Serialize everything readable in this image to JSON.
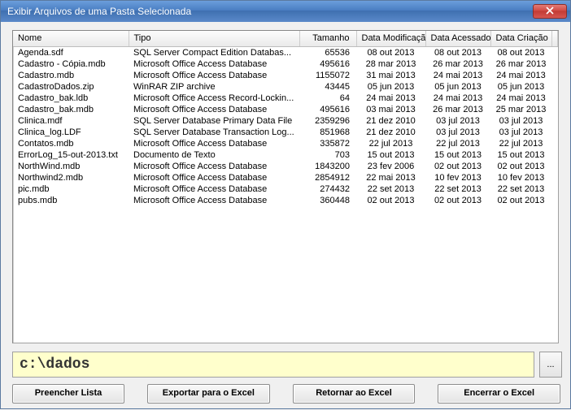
{
  "window": {
    "title": "Exibir Arquivos de uma Pasta Selecionada"
  },
  "columns": {
    "nome": "Nome",
    "tipo": "Tipo",
    "tamanho": "Tamanho",
    "modificacao": "Data Modificação",
    "acessado": "Data Acessado",
    "criacao": "Data Criação"
  },
  "rows": [
    {
      "nome": "Agenda.sdf",
      "tipo": "SQL Server Compact Edition Databas...",
      "tamanho": "65536",
      "mod": "08 out 2013",
      "acc": "08 out 2013",
      "cre": "08 out 2013"
    },
    {
      "nome": "Cadastro - Cópia.mdb",
      "tipo": "Microsoft Office Access Database",
      "tamanho": "495616",
      "mod": "28 mar 2013",
      "acc": "26 mar 2013",
      "cre": "26 mar 2013"
    },
    {
      "nome": "Cadastro.mdb",
      "tipo": "Microsoft Office Access Database",
      "tamanho": "1155072",
      "mod": "31 mai 2013",
      "acc": "24 mai 2013",
      "cre": "24 mai 2013"
    },
    {
      "nome": "CadastroDados.zip",
      "tipo": "WinRAR ZIP archive",
      "tamanho": "43445",
      "mod": "05 jun 2013",
      "acc": "05 jun 2013",
      "cre": "05 jun 2013"
    },
    {
      "nome": "Cadastro_bak.ldb",
      "tipo": "Microsoft Office Access Record-Lockin...",
      "tamanho": "64",
      "mod": "24 mai 2013",
      "acc": "24 mai 2013",
      "cre": "24 mai 2013"
    },
    {
      "nome": "Cadastro_bak.mdb",
      "tipo": "Microsoft Office Access Database",
      "tamanho": "495616",
      "mod": "03 mai 2013",
      "acc": "26 mar 2013",
      "cre": "25 mar 2013"
    },
    {
      "nome": "Clinica.mdf",
      "tipo": "SQL Server Database Primary Data File",
      "tamanho": "2359296",
      "mod": "21 dez 2010",
      "acc": "03 jul 2013",
      "cre": "03 jul 2013"
    },
    {
      "nome": "Clinica_log.LDF",
      "tipo": "SQL Server Database Transaction Log...",
      "tamanho": "851968",
      "mod": "21 dez 2010",
      "acc": "03 jul 2013",
      "cre": "03 jul 2013"
    },
    {
      "nome": "Contatos.mdb",
      "tipo": "Microsoft Office Access Database",
      "tamanho": "335872",
      "mod": "22 jul 2013",
      "acc": "22 jul 2013",
      "cre": "22 jul 2013"
    },
    {
      "nome": "ErrorLog_15-out-2013.txt",
      "tipo": "Documento de Texto",
      "tamanho": "703",
      "mod": "15 out 2013",
      "acc": "15 out 2013",
      "cre": "15 out 2013"
    },
    {
      "nome": "NorthWind.mdb",
      "tipo": "Microsoft Office Access Database",
      "tamanho": "1843200",
      "mod": "23 fev 2006",
      "acc": "02 out 2013",
      "cre": "02 out 2013"
    },
    {
      "nome": "Northwind2.mdb",
      "tipo": "Microsoft Office Access Database",
      "tamanho": "2854912",
      "mod": "22 mai 2013",
      "acc": "10 fev 2013",
      "cre": "10 fev 2013"
    },
    {
      "nome": "pic.mdb",
      "tipo": "Microsoft Office Access Database",
      "tamanho": "274432",
      "mod": "22 set 2013",
      "acc": "22 set 2013",
      "cre": "22 set 2013"
    },
    {
      "nome": "pubs.mdb",
      "tipo": "Microsoft Office Access Database",
      "tamanho": "360448",
      "mod": "02 out 2013",
      "acc": "02 out 2013",
      "cre": "02 out 2013"
    }
  ],
  "path": "c:\\dados",
  "browse": "...",
  "buttons": {
    "fill": "Preencher Lista",
    "export": "Exportar para o Excel",
    "return": "Retornar ao Excel",
    "close": "Encerrar o Excel"
  }
}
